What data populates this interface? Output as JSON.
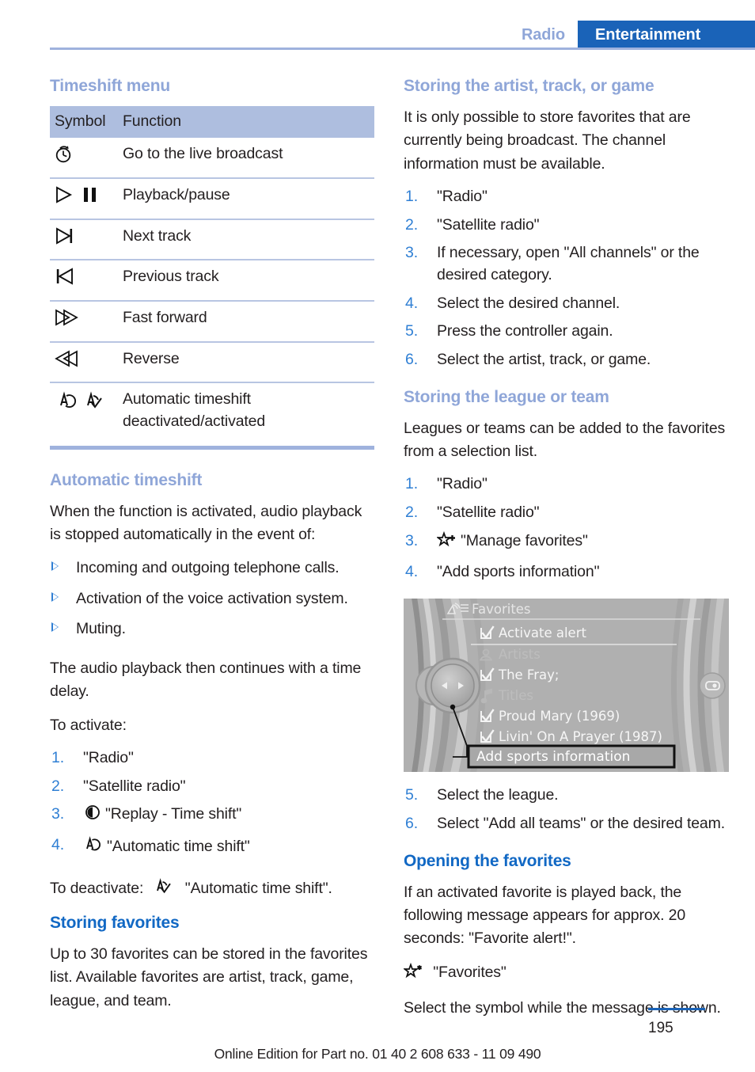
{
  "header": {
    "tab_inactive": "Radio",
    "tab_active": "Entertainment",
    "accent_blue": "#1a63b8",
    "muted_blue": "#8fa6d8"
  },
  "left_column": {
    "timeshift_menu": {
      "heading": "Timeshift menu",
      "table": {
        "columns": [
          "Symbol",
          "Function"
        ],
        "rows": [
          {
            "symbol": "live-broadcast-clock-icon",
            "function": "Go to the live broadcast"
          },
          {
            "symbol": "play-pause-icon",
            "function": "Playback/pause"
          },
          {
            "symbol": "next-track-icon",
            "function": "Next track"
          },
          {
            "symbol": "previous-track-icon",
            "function": "Previous track"
          },
          {
            "symbol": "fast-forward-icon",
            "function": "Fast forward"
          },
          {
            "symbol": "reverse-icon",
            "function": "Reverse"
          },
          {
            "symbol": "auto-timeshift-off-on-icon",
            "function": "Automatic timeshift deactivated/activated"
          }
        ]
      }
    },
    "automatic_timeshift": {
      "heading": "Automatic timeshift",
      "intro": "When the function is activated, audio playback is stopped automatically in the event of:",
      "bullets": [
        "Incoming and outgoing telephone calls.",
        "Activation of the voice activation system.",
        "Muting."
      ],
      "after_bullets": "The audio playback then continues with a time delay.",
      "activate_label": "To activate:",
      "steps": [
        {
          "icon": "",
          "text": "\"Radio\""
        },
        {
          "icon": "",
          "text": "\"Satellite radio\""
        },
        {
          "icon": "replay-timeshift-icon",
          "text": "\"Replay - Time shift\""
        },
        {
          "icon": "auto-timeshift-off-icon",
          "text": "\"Automatic time shift\""
        }
      ],
      "deactivate_prefix": "To deactivate:",
      "deactivate_icon": "auto-timeshift-on-icon",
      "deactivate_text": "\"Automatic time shift\"."
    },
    "storing_favorites": {
      "heading": "Storing favorites",
      "body": "Up to 30 favorites can be stored in the favorites list. Available favorites are artist, track, game, league, and team."
    }
  },
  "right_column": {
    "storing_artist": {
      "heading": "Storing the artist, track, or game",
      "body": "It is only possible to store favorites that are currently being broadcast. The channel information must be available.",
      "steps": [
        {
          "icon": "",
          "text": "\"Radio\""
        },
        {
          "icon": "",
          "text": "\"Satellite radio\""
        },
        {
          "icon": "",
          "text": "If necessary, open \"All channels\" or the desired category."
        },
        {
          "icon": "",
          "text": "Select the desired channel."
        },
        {
          "icon": "",
          "text": "Press the controller again."
        },
        {
          "icon": "",
          "text": "Select the artist, track, or game."
        }
      ]
    },
    "storing_league": {
      "heading": "Storing the league or team",
      "body": "Leagues or teams can be added to the favorites from a selection list.",
      "steps_before": [
        {
          "icon": "",
          "text": "\"Radio\""
        },
        {
          "icon": "",
          "text": "\"Satellite radio\""
        },
        {
          "icon": "star-plus-icon",
          "text": "\"Manage favorites\""
        },
        {
          "icon": "",
          "text": "\"Add sports information\""
        }
      ],
      "steps_after": [
        {
          "number": "5.",
          "text": "Select the league."
        },
        {
          "number": "6.",
          "text": "Select \"Add all teams\" or the desired team."
        }
      ]
    },
    "unit_screenshot": {
      "title": "Favorites",
      "title_icon": "satellite-radio-list-icon",
      "items": [
        {
          "icon": "checkbox-checked-icon",
          "label": "Activate alert",
          "dim": false
        },
        {
          "icon": "artist-person-icon",
          "label": "Artists",
          "dim": true
        },
        {
          "icon": "checkbox-checked-icon",
          "label": "The Fray;",
          "dim": false
        },
        {
          "icon": "music-note-icon",
          "label": "Titles",
          "dim": true
        },
        {
          "icon": "checkbox-checked-icon",
          "label": "Proud Mary (1969)",
          "dim": false
        },
        {
          "icon": "checkbox-checked-icon",
          "label": "Livin' On A Prayer (1987)",
          "dim": false
        }
      ],
      "callout_label": "Add sports information"
    },
    "opening_favorites": {
      "heading": "Opening the favorites",
      "body": "If an activated favorite is played back, the following message appears for approx. 20 seconds: \"Favorite alert!\".",
      "symbol_icon": "star-asterisk-icon",
      "symbol_label": "\"Favorites\"",
      "closing": "Select the symbol while the message is shown."
    }
  },
  "footer": {
    "note": "Online Edition for Part no. 01 40 2 608 633 - 11 09 490",
    "page_number": "195"
  }
}
